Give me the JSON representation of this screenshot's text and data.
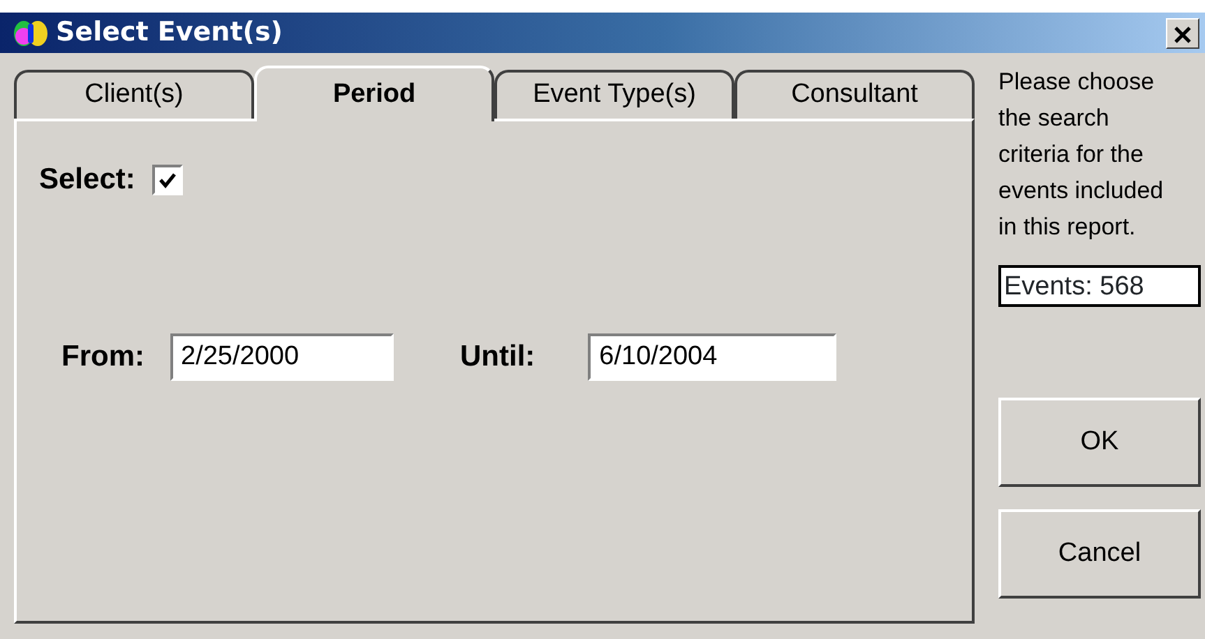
{
  "window": {
    "title": "Select Event(s)"
  },
  "tabs": [
    {
      "label": "Client(s)",
      "selected": false
    },
    {
      "label": "Period",
      "selected": true
    },
    {
      "label": "Event Type(s)",
      "selected": false
    },
    {
      "label": "Consultant",
      "selected": false
    }
  ],
  "select": {
    "label": "Select:",
    "checked": true
  },
  "from": {
    "label": "From:",
    "value": "2/25/2000"
  },
  "until": {
    "label": "Until:",
    "value": "6/10/2004"
  },
  "instructions": "Please choose the search criteria for the events included in this report.",
  "events_count": "Events: 568",
  "buttons": [
    "OK",
    "Cancel"
  ]
}
